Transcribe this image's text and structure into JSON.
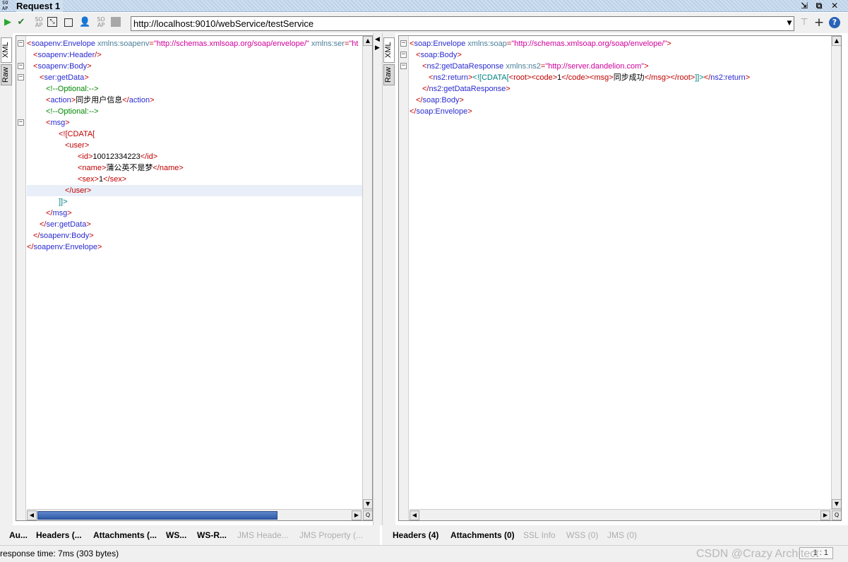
{
  "window": {
    "logo_text": "SO AP",
    "title": "Request 1",
    "controls": [
      "restore-icon",
      "maximize-icon",
      "close-icon"
    ]
  },
  "toolbar": {
    "icons": [
      "play-icon",
      "check-icon",
      "soap-icon",
      "resize-icon",
      "stop-icon",
      "user-icon",
      "soap-icon",
      "square-icon"
    ],
    "url": "http://localhost:9010/webService/testService",
    "right_icons": [
      "dropdown-arrow-icon",
      "tool-icon",
      "plus-icon",
      "help-icon"
    ]
  },
  "left": {
    "tabs": [
      "XML",
      "Raw"
    ],
    "bottom_tabs": [
      {
        "label": "Au...",
        "enabled": true
      },
      {
        "label": "Headers (...",
        "enabled": true
      },
      {
        "label": "Attachments (...",
        "enabled": true
      },
      {
        "label": "WS...",
        "enabled": true
      },
      {
        "label": "WS-R...",
        "enabled": true
      },
      {
        "label": "JMS Heade...",
        "enabled": false
      },
      {
        "label": "JMS Property (...",
        "enabled": false
      }
    ]
  },
  "right": {
    "tabs": [
      "XML",
      "Raw"
    ],
    "bottom_tabs": [
      {
        "label": "Headers (4)",
        "enabled": true
      },
      {
        "label": "Attachments (0)",
        "enabled": true
      },
      {
        "label": "SSL Info",
        "enabled": false
      },
      {
        "label": "WSS (0)",
        "enabled": false
      },
      {
        "label": "JMS (0)",
        "enabled": false
      }
    ]
  },
  "request_xml": [
    {
      "fold": true,
      "indent": 0,
      "parts": [
        [
          "ta",
          "<"
        ],
        [
          "tn",
          "soapenv:Envelope"
        ],
        [
          "an",
          " xmlns:soapenv"
        ],
        [
          "ta",
          "="
        ],
        [
          "av",
          "\"http://schemas.xmlsoap.org/soap/envelope/\""
        ],
        [
          "an",
          " xmlns:ser"
        ],
        [
          "ta",
          "="
        ],
        [
          "av",
          "\"ht"
        ]
      ]
    },
    {
      "fold": false,
      "indent": 1,
      "parts": [
        [
          "ta",
          "<"
        ],
        [
          "tn",
          "soapenv:Header"
        ],
        [
          "ta",
          "/>"
        ]
      ]
    },
    {
      "fold": true,
      "indent": 1,
      "parts": [
        [
          "ta",
          "<"
        ],
        [
          "tn",
          "soapenv:Body"
        ],
        [
          "ta",
          ">"
        ]
      ]
    },
    {
      "fold": true,
      "indent": 2,
      "parts": [
        [
          "ta",
          "<"
        ],
        [
          "tn",
          "ser:getData"
        ],
        [
          "ta",
          ">"
        ]
      ]
    },
    {
      "fold": false,
      "indent": 3,
      "parts": [
        [
          "cm",
          "<!--Optional:-->"
        ]
      ]
    },
    {
      "fold": false,
      "indent": 3,
      "parts": [
        [
          "ta",
          "<"
        ],
        [
          "tn",
          "action"
        ],
        [
          "ta",
          ">"
        ],
        [
          "tx",
          "同步用户信息"
        ],
        [
          "ta",
          "</"
        ],
        [
          "tn",
          "action"
        ],
        [
          "ta",
          ">"
        ]
      ]
    },
    {
      "fold": false,
      "indent": 3,
      "parts": [
        [
          "cm",
          "<!--Optional:-->"
        ]
      ]
    },
    {
      "fold": true,
      "indent": 3,
      "parts": [
        [
          "ta",
          "<"
        ],
        [
          "tn",
          "msg"
        ],
        [
          "ta",
          ">"
        ]
      ]
    },
    {
      "fold": false,
      "indent": 5,
      "parts": [
        [
          "ta",
          "<![CDATA["
        ]
      ]
    },
    {
      "fold": false,
      "indent": 6,
      "parts": [
        [
          "ta",
          "<user>"
        ]
      ]
    },
    {
      "fold": false,
      "indent": 8,
      "parts": [
        [
          "ta",
          "<id>"
        ],
        [
          "tx",
          "10012334223"
        ],
        [
          "ta",
          "</id>"
        ]
      ]
    },
    {
      "fold": false,
      "indent": 8,
      "parts": [
        [
          "ta",
          "<name>"
        ],
        [
          "tx",
          "蒲公英不是梦"
        ],
        [
          "ta",
          "</name>"
        ]
      ]
    },
    {
      "fold": false,
      "indent": 8,
      "parts": [
        [
          "ta",
          "<sex>"
        ],
        [
          "tx",
          "1"
        ],
        [
          "ta",
          "</sex>"
        ]
      ]
    },
    {
      "fold": false,
      "indent": 6,
      "hl": true,
      "parts": [
        [
          "ta",
          "</user>"
        ]
      ]
    },
    {
      "fold": false,
      "indent": 5,
      "parts": [
        [
          "cd",
          "]]>"
        ]
      ]
    },
    {
      "fold": false,
      "indent": 3,
      "parts": [
        [
          "ta",
          "</"
        ],
        [
          "tn",
          "msg"
        ],
        [
          "ta",
          ">"
        ]
      ]
    },
    {
      "fold": false,
      "indent": 2,
      "parts": [
        [
          "ta",
          "</"
        ],
        [
          "tn",
          "ser:getData"
        ],
        [
          "ta",
          ">"
        ]
      ]
    },
    {
      "fold": false,
      "indent": 1,
      "parts": [
        [
          "ta",
          "</"
        ],
        [
          "tn",
          "soapenv:Body"
        ],
        [
          "ta",
          ">"
        ]
      ]
    },
    {
      "fold": false,
      "indent": 0,
      "parts": [
        [
          "ta",
          "</"
        ],
        [
          "tn",
          "soapenv:Envelope"
        ],
        [
          "ta",
          ">"
        ]
      ]
    }
  ],
  "response_xml": [
    {
      "fold": true,
      "indent": 0,
      "parts": [
        [
          "ta",
          "<"
        ],
        [
          "tn",
          "soap:Envelope"
        ],
        [
          "an",
          " xmlns:soap"
        ],
        [
          "ta",
          "="
        ],
        [
          "av",
          "\"http://schemas.xmlsoap.org/soap/envelope/\""
        ],
        [
          "ta",
          ">"
        ]
      ]
    },
    {
      "fold": true,
      "indent": 1,
      "parts": [
        [
          "ta",
          "<"
        ],
        [
          "tn",
          "soap:Body"
        ],
        [
          "ta",
          ">"
        ]
      ]
    },
    {
      "fold": true,
      "indent": 2,
      "parts": [
        [
          "ta",
          "<"
        ],
        [
          "tn",
          "ns2:getDataResponse"
        ],
        [
          "an",
          " xmlns:ns2"
        ],
        [
          "ta",
          "="
        ],
        [
          "av",
          "\"http://server.dandelion.com\""
        ],
        [
          "ta",
          ">"
        ]
      ]
    },
    {
      "fold": false,
      "indent": 3,
      "parts": [
        [
          "ta",
          "<"
        ],
        [
          "tn",
          "ns2:return"
        ],
        [
          "ta",
          ">"
        ],
        [
          "cd",
          "<![CDATA["
        ],
        [
          "ta",
          "<root><code>"
        ],
        [
          "tx",
          "1"
        ],
        [
          "ta",
          "</code><msg>"
        ],
        [
          "tx",
          "同步成功"
        ],
        [
          "ta",
          "</msg></root>"
        ],
        [
          "cd",
          "]]>"
        ],
        [
          "ta",
          "</"
        ],
        [
          "tn",
          "ns2:return"
        ],
        [
          "ta",
          ">"
        ]
      ]
    },
    {
      "fold": false,
      "indent": 2,
      "parts": [
        [
          "ta",
          "</"
        ],
        [
          "tn",
          "ns2:getDataResponse"
        ],
        [
          "ta",
          ">"
        ]
      ]
    },
    {
      "fold": false,
      "indent": 1,
      "parts": [
        [
          "ta",
          "</"
        ],
        [
          "tn",
          "soap:Body"
        ],
        [
          "ta",
          ">"
        ]
      ]
    },
    {
      "fold": false,
      "indent": 0,
      "parts": [
        [
          "ta",
          "</"
        ],
        [
          "tn",
          "soap:Envelope"
        ],
        [
          "ta",
          ">"
        ]
      ]
    }
  ],
  "status": {
    "response": "response time: 7ms (303 bytes)",
    "watermark": "CSDN @Crazy Architect",
    "ratio": "1 : 1"
  }
}
